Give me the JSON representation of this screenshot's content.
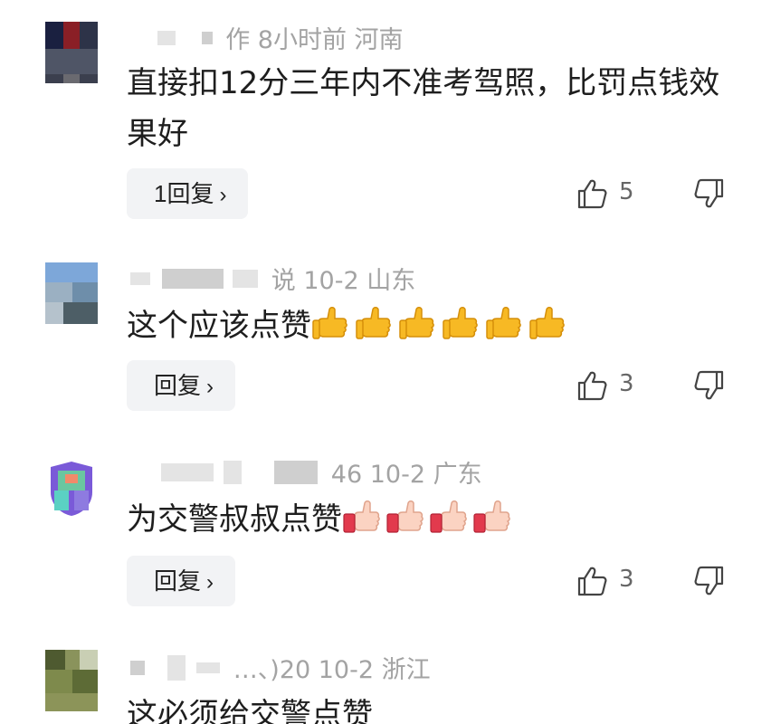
{
  "comments": [
    {
      "meta_visible": "作  8小时前  河南",
      "text": "直接扣12分三年内不准考驾照，比罚点钱效果好",
      "reply_label": "1回复",
      "like_count": "5"
    },
    {
      "meta_visible": "说  10-2  山东",
      "text": "这个应该点赞",
      "emoji_count": 6,
      "emoji_icon": "thumbs-up-yellow-icon",
      "reply_label": "回复",
      "like_count": "3"
    },
    {
      "meta_visible": "46  10-2  广东",
      "text": "为交警叔叔点赞",
      "emoji_count": 4,
      "emoji_icon": "thumbs-up-red-cuff-icon",
      "reply_label": "回复",
      "like_count": "3"
    },
    {
      "meta_visible": "…、)20  10-2  浙江",
      "text": "这必须给交警点赞"
    }
  ],
  "icons": {
    "like": "thumbs-up-outline-icon",
    "dislike": "thumbs-down-outline-icon",
    "chevron": "chevron-right-icon"
  },
  "colors": {
    "meta_text": "#a3a3a3",
    "reply_bg": "#f2f3f5",
    "emoji_yellow": "#f7b924",
    "emoji_red": "#e23a4d"
  }
}
